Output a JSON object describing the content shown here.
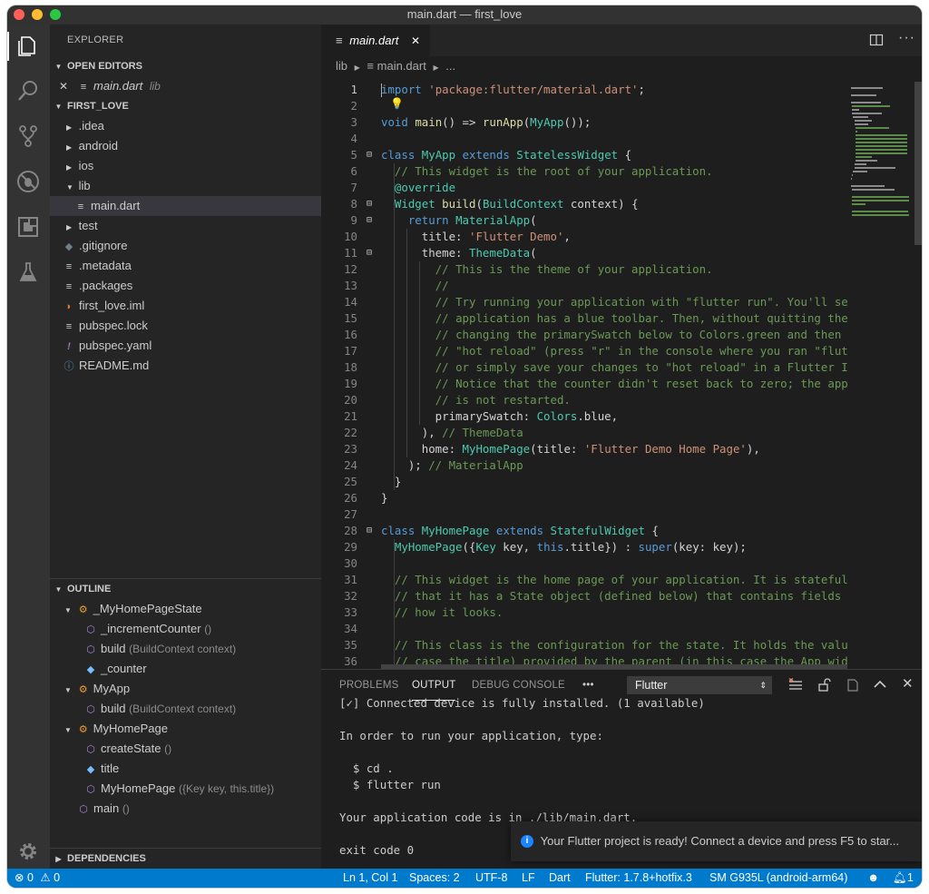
{
  "window": {
    "title": "main.dart — first_love"
  },
  "explorer": {
    "header": "EXPLORER",
    "open_editors": "OPEN EDITORS",
    "open_file": "main.dart",
    "open_file_dir": "lib",
    "project": "FIRST_LOVE",
    "files": [
      ".idea",
      "android",
      "ios",
      "lib",
      "main.dart",
      "test",
      ".gitignore",
      ".metadata",
      ".packages",
      "first_love.iml",
      "pubspec.lock",
      "pubspec.yaml",
      "README.md"
    ]
  },
  "outline": {
    "header": "OUTLINE",
    "items": [
      {
        "name": "_MyHomePageState",
        "detail": ""
      },
      {
        "name": "_incrementCounter",
        "detail": "()"
      },
      {
        "name": "build",
        "detail": "(BuildContext context)"
      },
      {
        "name": "_counter",
        "detail": ""
      },
      {
        "name": "MyApp",
        "detail": ""
      },
      {
        "name": "build",
        "detail": "(BuildContext context)"
      },
      {
        "name": "MyHomePage",
        "detail": ""
      },
      {
        "name": "createState",
        "detail": "()"
      },
      {
        "name": "title",
        "detail": ""
      },
      {
        "name": "MyHomePage",
        "detail": "({Key key, this.title})"
      },
      {
        "name": "main",
        "detail": "()"
      }
    ],
    "dependencies": "DEPENDENCIES"
  },
  "editor": {
    "tab": "main.dart",
    "breadcrumb": [
      "lib",
      "main.dart",
      "..."
    ],
    "lines": [
      "import 'package:flutter/material.dart';",
      "",
      "void main() => runApp(MyApp());",
      "",
      "class MyApp extends StatelessWidget {",
      "  // This widget is the root of your application.",
      "  @override",
      "  Widget build(BuildContext context) {",
      "    return MaterialApp(",
      "      title: 'Flutter Demo',",
      "      theme: ThemeData(",
      "        // This is the theme of your application.",
      "        //",
      "        // Try running your application with \"flutter run\". You'll see t",
      "        // application has a blue toolbar. Then, without quitting the ap",
      "        // changing the primarySwatch below to Colors.green and then inv",
      "        // \"hot reload\" (press \"r\" in the console where you ran \"flutter",
      "        // or simply save your changes to \"hot reload\" in a Flutter IDE)",
      "        // Notice that the counter didn't reset back to zero; the applic",
      "        // is not restarted.",
      "        primarySwatch: Colors.blue,",
      "      ), // ThemeData",
      "      home: MyHomePage(title: 'Flutter Demo Home Page'),",
      "    ); // MaterialApp",
      "  }",
      "}",
      "",
      "class MyHomePage extends StatefulWidget {",
      "  MyHomePage({Key key, this.title}) : super(key: key);",
      "",
      "  // This widget is the home page of your application. It is stateful, m",
      "  // that it has a State object (defined below) that contains fields tha",
      "  // how it looks.",
      "",
      "  // This class is the configuration for the state. It holds the values",
      "  // case the title) provided by the parent (in this case the App widget"
    ]
  },
  "panel": {
    "tabs": [
      "PROBLEMS",
      "OUTPUT",
      "DEBUG CONSOLE",
      "•••"
    ],
    "channel": "Flutter",
    "output": [
      "[✓] Connected device is fully installed. (1 available)",
      "",
      "In order to run your application, type:",
      "",
      "  $ cd .",
      "  $ flutter run",
      "",
      "Your application code is in ./lib/main.dart.",
      "",
      "exit code 0"
    ]
  },
  "notification": "Your Flutter project is ready! Connect a device and press F5 to star...",
  "status": {
    "errors": "0",
    "warnings": "0",
    "position": "Ln 1, Col 1",
    "spaces": "Spaces: 2",
    "encoding": "UTF-8",
    "eol": "LF",
    "language": "Dart",
    "flutter": "Flutter: 1.7.8+hotfix.3",
    "device": "SM G935L (android-arm64)",
    "bell_count": "1"
  },
  "colors": {
    "accent": "#007acc",
    "sidebar": "#252526",
    "editor": "#1e1e1e",
    "activity": "#333333"
  }
}
